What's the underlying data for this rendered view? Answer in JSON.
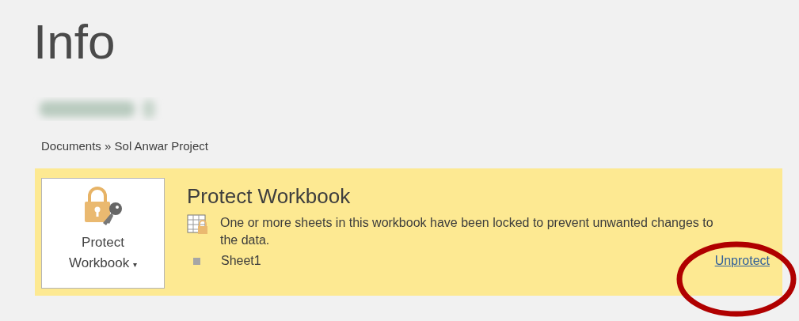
{
  "page_title": "Info",
  "breadcrumb": "Documents » Sol Anwar Project",
  "protect_panel": {
    "button": {
      "line1": "Protect",
      "line2": "Workbook",
      "caret": "▾"
    },
    "title": "Protect Workbook",
    "description": "One or more sheets in this workbook have been locked to prevent unwanted changes to the data.",
    "sheets": [
      "Sheet1"
    ],
    "link": "Unprotect"
  },
  "annotation": {
    "kind": "ellipse",
    "color": "#b00000"
  }
}
